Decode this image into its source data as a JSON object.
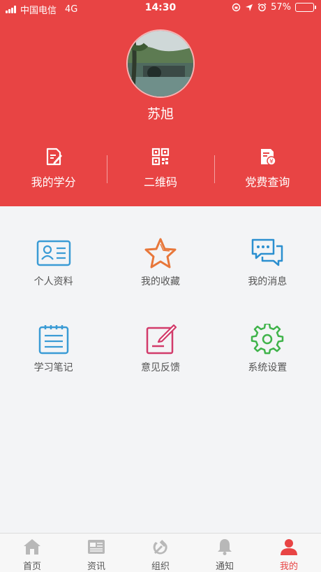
{
  "status_bar": {
    "carrier": "中国电信",
    "network": "4G",
    "time": "14:30",
    "battery_pct": "57%",
    "battery_level": 0.57
  },
  "profile": {
    "name": "苏旭"
  },
  "quick_actions": [
    {
      "label": "我的学分",
      "icon": "edit-document-icon"
    },
    {
      "label": "二维码",
      "icon": "qr-code-icon"
    },
    {
      "label": "党费查询",
      "icon": "fee-receipt-icon"
    }
  ],
  "menu": [
    {
      "label": "个人资料",
      "icon": "id-card-icon",
      "color": "#3a9bd5"
    },
    {
      "label": "我的收藏",
      "icon": "star-icon",
      "color": "#e8773a"
    },
    {
      "label": "我的消息",
      "icon": "chat-bubbles-icon",
      "color": "#2b8fd0"
    },
    {
      "label": "学习笔记",
      "icon": "notepad-icon",
      "color": "#3a9bd5"
    },
    {
      "label": "意见反馈",
      "icon": "feedback-pencil-icon",
      "color": "#d23a6a"
    },
    {
      "label": "系统设置",
      "icon": "gear-icon",
      "color": "#3fb34a"
    }
  ],
  "tabs": [
    {
      "label": "首页",
      "icon": "home-icon",
      "active": false
    },
    {
      "label": "资讯",
      "icon": "news-icon",
      "active": false
    },
    {
      "label": "组织",
      "icon": "hammer-sickle-icon",
      "active": false
    },
    {
      "label": "通知",
      "icon": "bell-icon",
      "active": false
    },
    {
      "label": "我的",
      "icon": "person-icon",
      "active": true
    }
  ],
  "colors": {
    "brand_red": "#e84444",
    "background": "#f3f4f6",
    "tab_inactive": "#b8b8b8"
  }
}
